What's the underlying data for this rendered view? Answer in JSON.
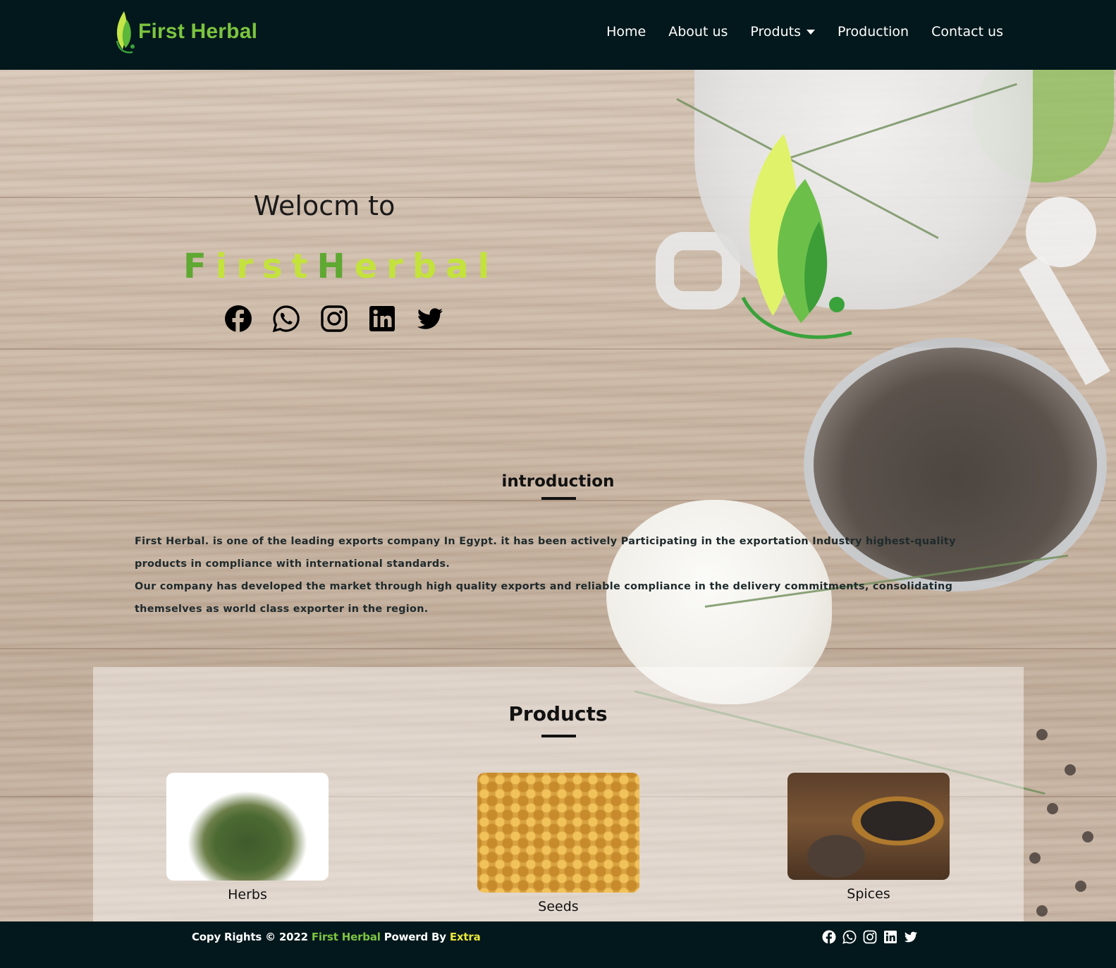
{
  "brand": {
    "name": "First Herbal"
  },
  "nav": {
    "items": [
      {
        "label": "Home"
      },
      {
        "label": "About us"
      },
      {
        "label": "Produts"
      },
      {
        "label": "Production"
      },
      {
        "label": "Contact us"
      }
    ]
  },
  "hero": {
    "welcome": "Welocm to",
    "brand_parts": [
      "F",
      "irst",
      "H",
      "erbal"
    ],
    "social_icons": [
      "facebook-icon",
      "whatsapp-icon",
      "instagram-icon",
      "linkedin-icon",
      "twitter-icon"
    ]
  },
  "intro": {
    "title": "introduction",
    "paragraph1": "First Herbal. is one of the leading exports company In Egypt. it has been actively Participating in the exportation Industry highest-quality products in compliance with international standards.",
    "paragraph2": "Our company has developed the market through high quality exports and reliable compliance in the delivery commitments, consolidating themselves as world class exporter in the region."
  },
  "products": {
    "title": "Products",
    "items": [
      {
        "name": "Herbs"
      },
      {
        "name": "Seeds"
      },
      {
        "name": "Spices"
      }
    ]
  },
  "footer": {
    "prefix": "Copy Rights © 2022 ",
    "brand": "First Herbal",
    "powered": " Powerd By ",
    "powered_by": "Extra",
    "social_icons": [
      "facebook-icon",
      "whatsapp-icon",
      "instagram-icon",
      "linkedin-icon",
      "twitter-icon"
    ]
  },
  "colors": {
    "nav_bg": "#03181c",
    "brand_green": "#7cc440",
    "brand_dark_green": "#5fa832",
    "brand_light_green": "#c4e23c",
    "powered_by_yellow": "#e8e63a"
  }
}
